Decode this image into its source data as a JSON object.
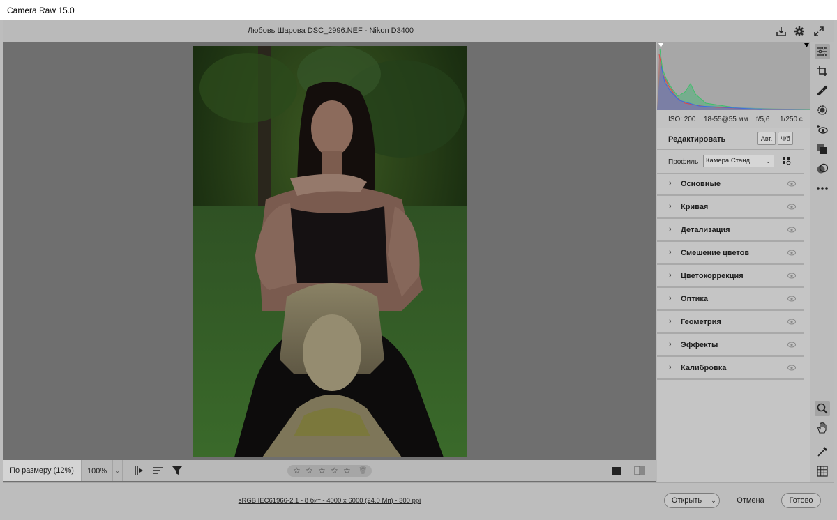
{
  "window": {
    "title": "Camera Raw 15.0"
  },
  "document": {
    "title": "Любовь Шарова DSC_2996.NEF  -  Nikon D3400"
  },
  "histogram": {
    "camera_info": {
      "iso": "ISO: 200",
      "lens": "18-55@55 мм",
      "aperture": "f/5,6",
      "shutter": "1/250 с"
    },
    "colors": {
      "red": "#e04646",
      "green": "#3fbf6a",
      "blue": "#3a6fe0"
    }
  },
  "edit_panel": {
    "title": "Редактировать",
    "auto_label": "Авт.",
    "bw_label": "Ч/б",
    "profile_label": "Профиль",
    "profile_value": "Камера Станд...",
    "sections": [
      {
        "label": "Основные"
      },
      {
        "label": "Кривая"
      },
      {
        "label": "Детализация"
      },
      {
        "label": "Смешение цветов"
      },
      {
        "label": "Цветокоррекция"
      },
      {
        "label": "Оптика"
      },
      {
        "label": "Геометрия"
      },
      {
        "label": "Эффекты"
      },
      {
        "label": "Калибровка"
      }
    ]
  },
  "toolbar_right": {
    "icons": [
      "edit-sliders-icon",
      "crop-icon",
      "healing-brush-icon",
      "masking-icon",
      "red-eye-icon",
      "snapshots-icon",
      "presets-icon",
      "more-icon",
      "zoom-icon",
      "hand-icon",
      "white-balance-icon",
      "grid-icon"
    ]
  },
  "filmstrip_bar": {
    "fit_label": "По размеру (12%)",
    "zoom_value": "100%",
    "rating_stars": 5,
    "rating_value": 0
  },
  "bottom": {
    "file_info": "sRGB IEC61966-2.1 - 8 бит - 4000 x 6000 (24,0 Мп) - 300 ppi",
    "open_label": "Открыть",
    "cancel_label": "Отмена",
    "done_label": "Готово"
  }
}
